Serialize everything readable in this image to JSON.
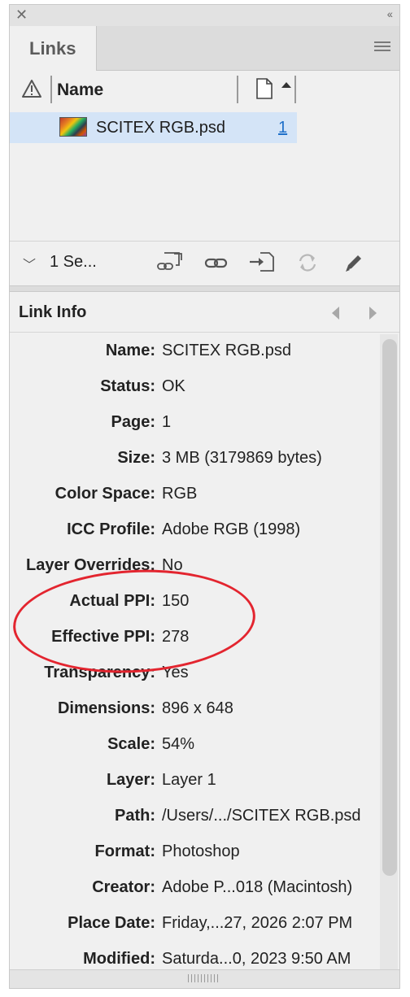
{
  "panel": {
    "tab_title": "Links",
    "columns": {
      "name_header": "Name"
    },
    "links": [
      {
        "name": "SCITEX RGB.psd",
        "page": "1"
      }
    ],
    "selection_label": "1 Se...",
    "icons": [
      "relink-from-cc-icon",
      "relink-icon",
      "goto-link-icon",
      "update-link-icon",
      "edit-original-icon"
    ]
  },
  "link_info": {
    "title": "Link Info",
    "rows": [
      {
        "label": "Name:",
        "value": "SCITEX RGB.psd"
      },
      {
        "label": "Status:",
        "value": "OK"
      },
      {
        "label": "Page:",
        "value": "1"
      },
      {
        "label": "Size:",
        "value": "3 MB (3179869 bytes)"
      },
      {
        "label": "Color Space:",
        "value": "RGB"
      },
      {
        "label": "ICC Profile:",
        "value": "Adobe RGB (1998)"
      },
      {
        "label": "Layer Overrides:",
        "value": "No"
      },
      {
        "label": "Actual PPI:",
        "value": "150"
      },
      {
        "label": "Effective PPI:",
        "value": "278"
      },
      {
        "label": "Transparency:",
        "value": "Yes"
      },
      {
        "label": "Dimensions:",
        "value": "896 x 648"
      },
      {
        "label": "Scale:",
        "value": "54%"
      },
      {
        "label": "Layer:",
        "value": "Layer 1"
      },
      {
        "label": "Path:",
        "value": "/Users/.../SCITEX RGB.psd"
      },
      {
        "label": "Format:",
        "value": "Photoshop"
      },
      {
        "label": "Creator:",
        "value": "Adobe P...018 (Macintosh)"
      },
      {
        "label": "Place Date:",
        "value": "Friday,...27, 2026 2:07 PM"
      },
      {
        "label": "Modified:",
        "value": "Saturda...0, 2023 9:50 AM"
      }
    ]
  },
  "colors": {
    "selection": "#d4e4f7",
    "link": "#1e6fc9",
    "annotation": "#e3252f"
  }
}
